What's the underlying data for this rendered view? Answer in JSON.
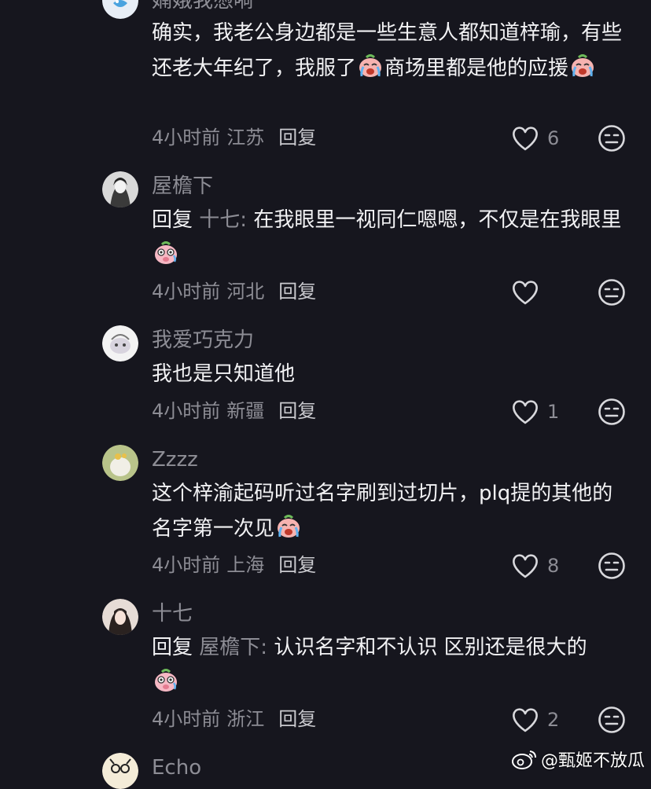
{
  "comments": [
    {
      "username": "婻娥我憑嗬",
      "text_parts": [
        "确实，我老公身边都是一些生意人都知道梓瑜，有些还老大年纪了，我服了",
        "商场里都是他的应援"
      ],
      "time": "4小时前",
      "location": "江苏",
      "reply_label": "回复",
      "likes": "6",
      "avatar_color": "#e8eef6"
    },
    {
      "username": "屋檐下",
      "reply_prefix": "回复",
      "reply_target": "十七:",
      "text_parts": [
        "在我眼里一视同仁嗯嗯，不仅是在我眼里"
      ],
      "time": "4小时前",
      "location": "河北",
      "reply_label": "回复",
      "likes": "",
      "avatar_color": "#d9d9d9"
    },
    {
      "username": "我爱巧克力",
      "text_parts": [
        "我也是只知道他"
      ],
      "time": "4小时前",
      "location": "新疆",
      "reply_label": "回复",
      "likes": "1",
      "avatar_color": "#f3f3f3"
    },
    {
      "username": "Zzzz",
      "text_parts": [
        "这个梓渝起码听过名字刷到过切片，plq提的其他的名字第一次见"
      ],
      "time": "4小时前",
      "location": "上海",
      "reply_label": "回复",
      "likes": "8",
      "avatar_color": "#b9c48a"
    },
    {
      "username": "十七",
      "reply_prefix": "回复",
      "reply_target": "屋檐下:",
      "text_parts": [
        "认识名字和不认识 区别还是很大的"
      ],
      "time": "4小时前",
      "location": "浙江",
      "reply_label": "回复",
      "likes": "2",
      "avatar_color": "#e6dcd6"
    },
    {
      "username": "Echo",
      "avatar_color": "#f4ecd8"
    }
  ],
  "watermark": {
    "text": "@甄姬不放瓜",
    "icon": "weibo-logo"
  },
  "icons": {
    "like": "heart-outline-icon",
    "react": "emoji-reaction-icon",
    "crying_emoji": "crying-laughing-emoji",
    "shocked_emoji": "shocked-pig-emoji"
  },
  "colors": {
    "background": "#16161e",
    "primary_text": "#f2f2f4",
    "secondary_text": "#8d8d95"
  }
}
